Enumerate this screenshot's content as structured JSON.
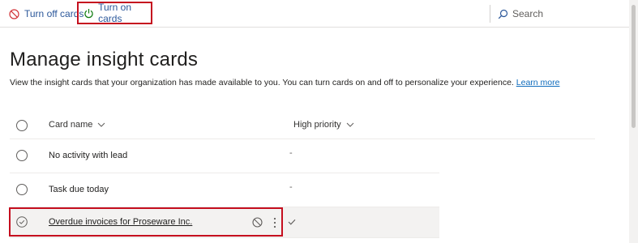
{
  "toolbar": {
    "turn_off_label": "Turn off cards",
    "turn_on_label": "Turn on cards",
    "search_placeholder": "Search"
  },
  "page": {
    "title": "Manage insight cards",
    "description": "View the insight cards that your organization has made available to you. You can turn cards on and off to personalize your experience.",
    "learn_more": "Learn more"
  },
  "grid": {
    "columns": [
      "Card name",
      "High priority"
    ],
    "rows": [
      {
        "name": "No activity with lead",
        "priority": "-",
        "selected": false
      },
      {
        "name": "Task due today",
        "priority": "-",
        "selected": false
      },
      {
        "name": "Overdue invoices for Proseware Inc.",
        "priority": "",
        "selected": true
      }
    ]
  },
  "colors": {
    "accent": "#2b579a",
    "highlight": "#c50f1f",
    "on_icon": "#107c10",
    "off_icon": "#d13438"
  },
  "icons": [
    "block-icon",
    "power-icon",
    "search-icon",
    "chevron-down-icon",
    "check-circle-icon",
    "more-vertical-icon",
    "checkmark-icon"
  ]
}
